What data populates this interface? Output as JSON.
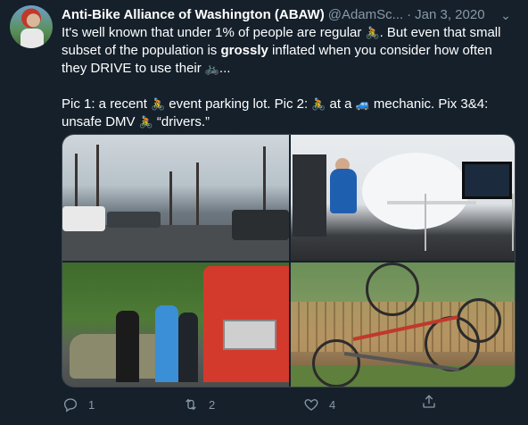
{
  "tweet": {
    "display_name": "Anti-Bike Alliance of Washington (ABAW)",
    "handle": "@AdamSc...",
    "separator": "·",
    "date": "Jan 3, 2020",
    "line1_a": "It's well known that under 1% of people are regular ",
    "line1_b": ". But even that small subset of the population is ",
    "bold_word": "grossly",
    "line1_c": " inflated when you consider how often they DRIVE to use their ",
    "line1_d": "...",
    "line2_a": "Pic 1: a recent ",
    "line2_b": " event parking lot. Pic 2: ",
    "line2_c": " at a ",
    "line2_d": " mechanic. Pix 3&4: unsafe DMV ",
    "line2_e": " “drivers.”"
  },
  "icons": {
    "cyclist": "🚴",
    "bike": "🚲",
    "car": "🚙",
    "caret": "⌄"
  },
  "actions": {
    "reply_count": "1",
    "retweet_count": "2",
    "like_count": "4"
  },
  "colors": {
    "background": "#15202b",
    "secondary_text": "#8899a6",
    "border": "#38444d"
  }
}
